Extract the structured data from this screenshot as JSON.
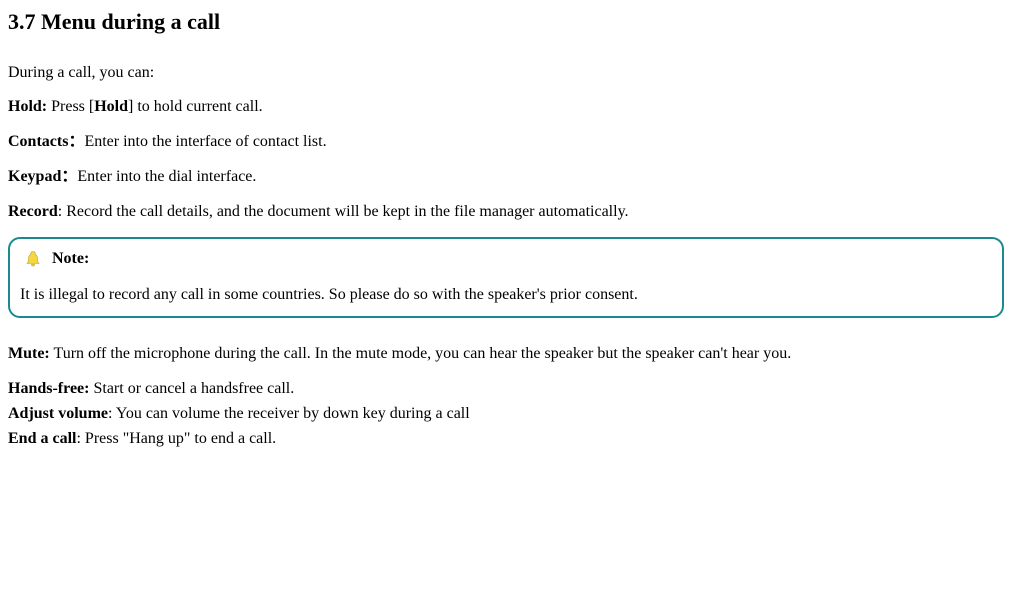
{
  "heading": "3.7 Menu during a call",
  "intro": "During a call, you can:",
  "items": {
    "hold": {
      "label": "Hold:",
      "pre": " Press [",
      "key": "Hold",
      "post": "] to hold current call."
    },
    "contacts": {
      "label": "Contacts：",
      "desc": "Enter into the interface of contact list."
    },
    "keypad": {
      "label": "Keypad：",
      "desc": "Enter into the dial interface."
    },
    "record": {
      "label": "Record",
      "desc": ": Record the call details, and the document will be kept in the file manager automatically."
    },
    "mute": {
      "label": "Mute:",
      "desc": " Turn off the microphone during the call. In the mute mode, you can hear the speaker but the speaker can't hear you."
    },
    "handsfree": {
      "label": "Hands-free:",
      "desc": " Start or cancel a handsfree call."
    },
    "volume": {
      "label": "Adjust volume",
      "desc": ": You can volume the receiver by down key during a call"
    },
    "endcall": {
      "label": "End a call",
      "desc": ": Press \"Hang up\" to end a call."
    }
  },
  "note": {
    "title": "Note:",
    "body": "It is illegal to record any call in some countries. So please do so with the speaker's prior consent."
  }
}
